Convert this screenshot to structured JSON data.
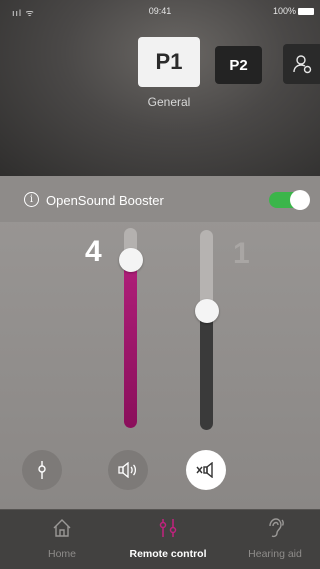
{
  "status_bar": {
    "signal": "ııl ᯤ",
    "time": "09:41",
    "battery": "100%"
  },
  "programs": {
    "items": [
      {
        "label": "P1",
        "selected": true
      },
      {
        "label": "P2",
        "selected": false
      },
      {
        "icon": "person-settings-icon",
        "selected": false
      }
    ],
    "current_name": "General"
  },
  "booster": {
    "title": "OpenSound Booster",
    "enabled": true,
    "accent_color": "#3bb54a"
  },
  "volume": {
    "left": {
      "value": "4",
      "level": 0.85,
      "color": "#b01f7a"
    },
    "right": {
      "value": "1",
      "level": 0.6,
      "color": "#3a3a3a"
    }
  },
  "controls": [
    {
      "icon": "tune-icon"
    },
    {
      "icon": "speaker-icon"
    },
    {
      "icon": "mute-speaker-icon",
      "active": true
    }
  ],
  "tabs": [
    {
      "label": "Home",
      "icon": "home-icon",
      "active": false
    },
    {
      "label": "Remote control",
      "icon": "sliders-icon",
      "active": true,
      "color": "#c2227f"
    },
    {
      "label": "Hearing aid",
      "icon": "ear-icon",
      "active": false
    }
  ]
}
